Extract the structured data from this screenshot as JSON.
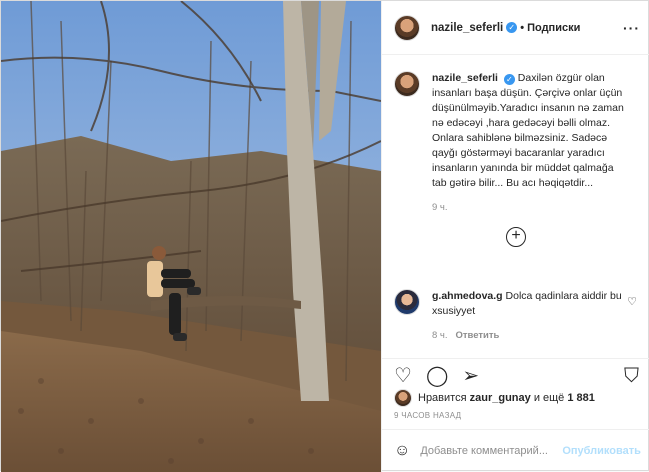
{
  "post": {
    "username": "nazile_seferli",
    "follow_status": "Подписки",
    "more_icon": "more-horizontal-icon"
  },
  "caption": {
    "username": "nazile_seferli",
    "text": "Daxilən özgür olan insanları başa düşün. Çərçivə onlar üçün düşünülməyib.Yaradıcı insanın nə zaman nə edəcəyi ,hara gedəcəyi bəlli olmaz. Onlara sahiblənə bilməzsiniz. Sadəcə qayğı göstərməyi bacaranlar yaradıcı insanların yanında bir müddət qalmağa tab gətirə bilir... Bu acı həqiqətdir...",
    "age": "9 ч."
  },
  "comment": {
    "username": "g.ahmedova.g",
    "text": "Dolca qadinlara aiddir bu xsusiyyet",
    "age": "8 ч.",
    "reply": "Ответить"
  },
  "likes": {
    "prefix": "Нравится",
    "user": "zaur_gunay",
    "middle": "и ещё",
    "count": "1 881"
  },
  "timestamp": "9 ЧАСОВ НАЗАД",
  "add_comment": {
    "placeholder": "Добавьте комментарий...",
    "publish": "Опубликовать"
  }
}
